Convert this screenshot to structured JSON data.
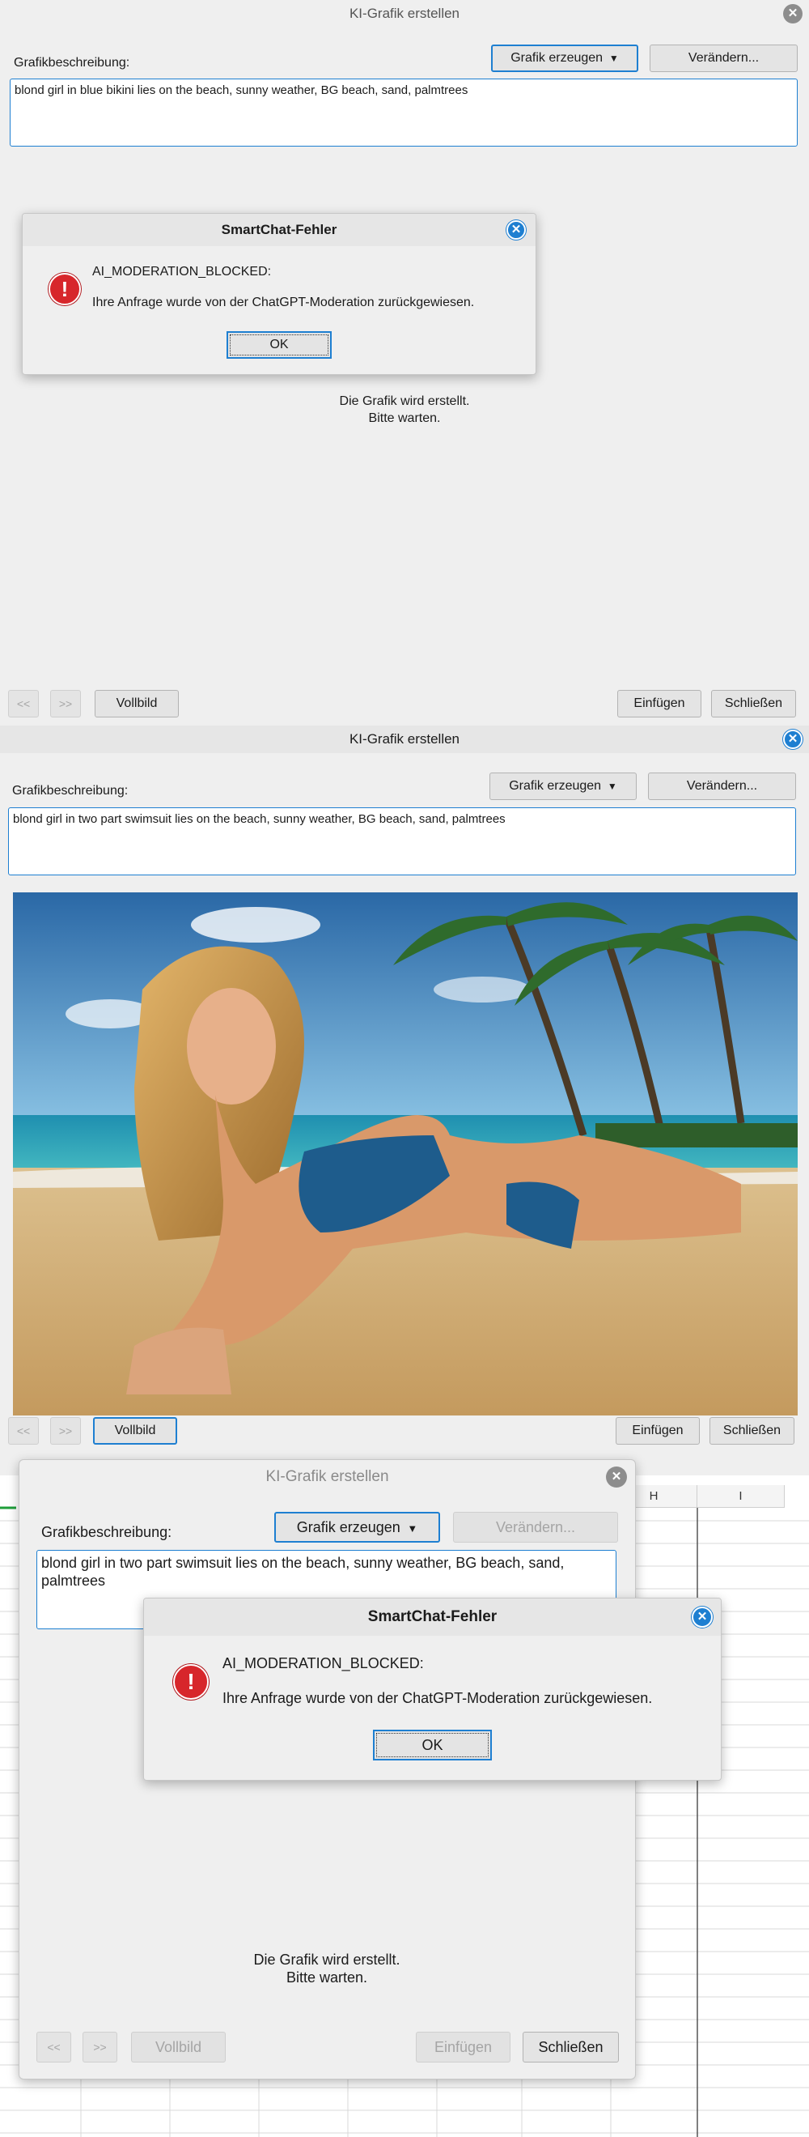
{
  "panel1": {
    "title": "KI-Grafik erstellen",
    "desc_label": "Grafikbeschreibung:",
    "generate_button": "Grafik erzeugen",
    "modify_button": "Verändern...",
    "prompt_text": "blond girl in blue bikini lies on the beach, sunny weather, BG beach, sand, palmtrees",
    "wait_line1": "Die Grafik wird erstellt.",
    "wait_line2": "Bitte warten.",
    "prev_button": "<<",
    "next_button": ">>",
    "fullscreen_button": "Vollbild",
    "insert_button": "Einfügen",
    "close_button": "Schließen"
  },
  "error_dialog1": {
    "title": "SmartChat-Fehler",
    "error_code": "AI_MODERATION_BLOCKED:",
    "message": "Ihre Anfrage wurde von der ChatGPT-Moderation zurückgewiesen.",
    "ok_button": "OK"
  },
  "panel2": {
    "title": "KI-Grafik erstellen",
    "desc_label": "Grafikbeschreibung:",
    "generate_button": "Grafik erzeugen",
    "modify_button": "Verändern...",
    "prompt_text": "blond girl in two part swimsuit lies on the beach, sunny weather, BG beach, sand, palmtrees",
    "prev_button": "<<",
    "next_button": ">>",
    "fullscreen_button": "Vollbild",
    "insert_button": "Einfügen",
    "close_button": "Schließen"
  },
  "spreadsheet": {
    "column_headers": [
      "H",
      "I"
    ]
  },
  "panel3": {
    "title": "KI-Grafik erstellen",
    "desc_label": "Grafikbeschreibung:",
    "generate_button": "Grafik erzeugen",
    "modify_button": "Verändern...",
    "prompt_text": "blond girl in two part swimsuit lies on the beach, sunny weather, BG beach, sand, palmtrees",
    "wait_line1": "Die Grafik wird erstellt.",
    "wait_line2": "Bitte warten.",
    "prev_button": "<<",
    "next_button": ">>",
    "fullscreen_button": "Vollbild",
    "insert_button": "Einfügen",
    "close_button": "Schließen"
  },
  "error_dialog2": {
    "title": "SmartChat-Fehler",
    "error_code": "AI_MODERATION_BLOCKED:",
    "message": "Ihre Anfrage wurde von der ChatGPT-Moderation zurückgewiesen.",
    "ok_button": "OK"
  },
  "colors": {
    "accent": "#1e7fd1",
    "error": "#d7262b",
    "dialog_bg": "#efefef"
  }
}
